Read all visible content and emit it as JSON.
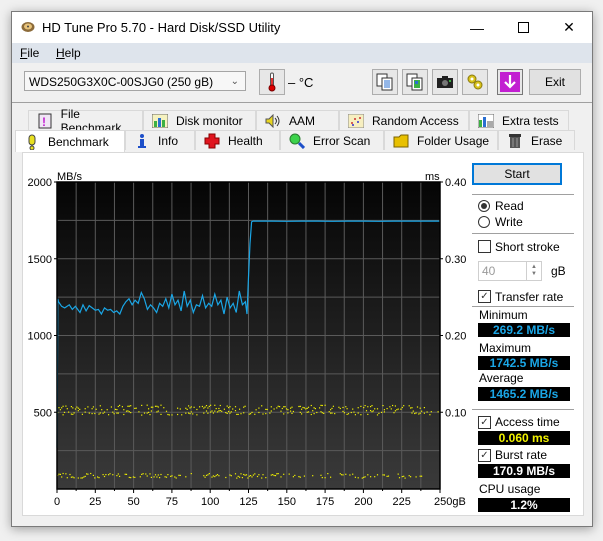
{
  "window": {
    "title": "HD Tune Pro 5.70 - Hard Disk/SSD Utility",
    "controls": {
      "minimize": "—",
      "maximize": "☐",
      "close": "✕"
    }
  },
  "menu": {
    "items": [
      {
        "label": "File",
        "accel": "F",
        "rest": "ile"
      },
      {
        "label": "Help",
        "accel": "H",
        "rest": "elp"
      }
    ]
  },
  "toolbar": {
    "drive": "WDS250G3X0C-00SJG0 (250 gB)",
    "temperature": "– °C",
    "buttons": [
      "copy-text-icon",
      "copy-screenshot-icon",
      "camera-icon",
      "options-icon",
      "save-download-icon"
    ],
    "exit_label": "Exit"
  },
  "tabs": {
    "row1": [
      {
        "label": "File Benchmark",
        "icon": "file-benchmark-icon"
      },
      {
        "label": "Disk monitor",
        "icon": "disk-monitor-icon"
      },
      {
        "label": "AAM",
        "icon": "speaker-icon"
      },
      {
        "label": "Random Access",
        "icon": "random-access-icon"
      },
      {
        "label": "Extra tests",
        "icon": "extra-tests-icon"
      }
    ],
    "row2": [
      {
        "label": "Benchmark",
        "icon": "exclamation-icon",
        "active": true
      },
      {
        "label": "Info",
        "icon": "info-icon"
      },
      {
        "label": "Health",
        "icon": "health-cross-icon"
      },
      {
        "label": "Error Scan",
        "icon": "magnifier-icon"
      },
      {
        "label": "Folder Usage",
        "icon": "folder-icon"
      },
      {
        "label": "Erase",
        "icon": "trash-icon"
      }
    ]
  },
  "side": {
    "start_label": "Start",
    "read_label": "Read",
    "write_label": "Write",
    "read_selected": true,
    "short_stroke_label": "Short stroke",
    "short_stroke_checked": false,
    "short_stroke_value": "40",
    "short_stroke_unit": "gB",
    "transfer_rate_label": "Transfer rate",
    "transfer_rate_checked": true,
    "minimum_label": "Minimum",
    "minimum_value": "269.2 MB/s",
    "maximum_label": "Maximum",
    "maximum_value": "1742.5 MB/s",
    "average_label": "Average",
    "average_value": "1465.2 MB/s",
    "access_time_label": "Access time",
    "access_time_checked": true,
    "access_time_value": "0.060 ms",
    "burst_rate_label": "Burst rate",
    "burst_rate_checked": true,
    "burst_rate_value": "170.9 MB/s",
    "cpu_label": "CPU usage",
    "cpu_value": "1.2%"
  },
  "colors": {
    "transfer_line": "#1aa6e6",
    "access_points": "#f2f200",
    "readout_blue": "#1aa6e6",
    "readout_yellow": "#f2f200",
    "readout_white": "#ffffff"
  },
  "chart_data": {
    "type": "line",
    "title": "",
    "xlabel": "gB",
    "ylabel": "MB/s",
    "y2label": "ms",
    "xlim": [
      0,
      250
    ],
    "ylim": [
      0,
      2000
    ],
    "y2lim": [
      0,
      0.4
    ],
    "x_ticks": [
      "0",
      "25",
      "50",
      "75",
      "100",
      "125",
      "150",
      "175",
      "200",
      "225",
      "250gB"
    ],
    "y_ticks": [
      "500",
      "1000",
      "1500",
      "2000"
    ],
    "y2_ticks": [
      "0.10",
      "0.20",
      "0.30",
      "0.40"
    ],
    "grid": true,
    "series": [
      {
        "name": "Transfer rate (MB/s)",
        "axis": "left",
        "x": [
          0,
          0.5,
          1,
          3,
          5,
          8,
          10,
          12,
          15,
          17,
          19,
          21,
          23,
          25,
          27,
          29,
          31,
          33,
          35,
          37,
          39,
          41,
          43,
          45,
          47,
          49,
          51,
          53,
          55,
          57,
          59,
          61,
          63,
          65,
          67,
          69,
          71,
          73,
          75,
          77,
          79,
          81,
          83,
          85,
          87,
          89,
          91,
          93,
          95,
          97,
          99,
          101,
          103,
          105,
          107,
          109,
          111,
          113,
          115,
          117,
          119,
          121,
          123,
          124,
          125,
          126,
          127,
          128,
          130,
          140,
          150,
          160,
          170,
          180,
          190,
          200,
          210,
          220,
          230,
          240,
          250
        ],
        "values": [
          269,
          1240,
          1220,
          1190,
          1180,
          1200,
          1170,
          1190,
          1150,
          1200,
          1160,
          1195,
          1180,
          1165,
          1170,
          1140,
          1180,
          1165,
          1170,
          1150,
          1160,
          1140,
          1190,
          1220,
          1240,
          1200,
          1230,
          1210,
          1280,
          1240,
          1170,
          1200,
          1180,
          1150,
          1210,
          1190,
          1240,
          1180,
          1270,
          1200,
          1230,
          1160,
          1290,
          1190,
          1230,
          1150,
          1200,
          1190,
          1260,
          1180,
          1210,
          1190,
          1270,
          1200,
          1230,
          1140,
          1250,
          1180,
          1210,
          1150,
          1290,
          1200,
          1220,
          1140,
          1380,
          1600,
          1740,
          1745,
          1745,
          1745,
          1744,
          1745,
          1745,
          1744,
          1745,
          1745,
          1744,
          1745,
          1745,
          1745,
          1745
        ]
      },
      {
        "name": "Access time (ms)",
        "axis": "right",
        "note": "scatter bands",
        "bands": [
          {
            "center_ms": 0.1,
            "x_range": [
              0,
              250
            ]
          },
          {
            "center_ms": 0.107,
            "x_range": [
              0,
              240
            ]
          },
          {
            "center_ms": 0.018,
            "x_range": [
              0,
              240
            ]
          }
        ]
      }
    ]
  }
}
